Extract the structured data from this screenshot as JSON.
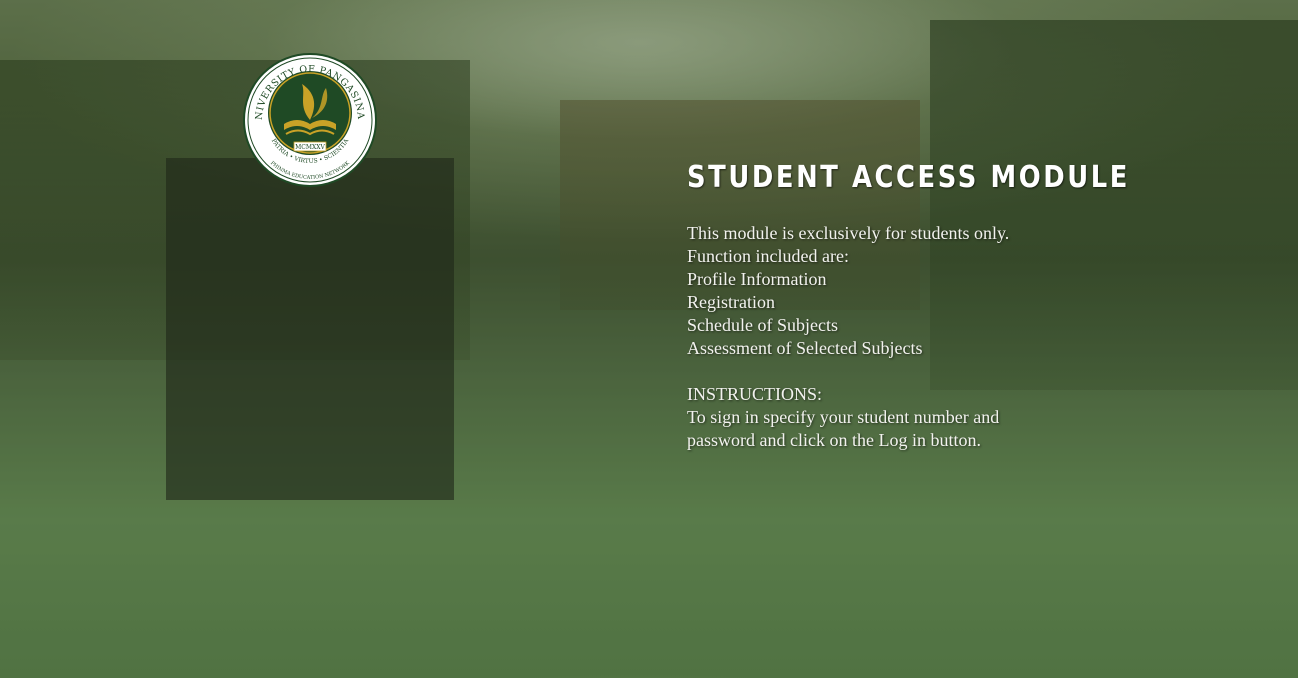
{
  "seal": {
    "top_text": "UNIVERSITY OF PANGASINAN",
    "motto": "PATRIA • VIRTUS • SCIENTIA",
    "year": "MCMXXV",
    "network": "PHINMA EDUCATION NETWORK",
    "colors": {
      "ring": "#ffffff",
      "inner": "#1f4a25",
      "gold": "#c9a227"
    }
  },
  "info": {
    "title": "STUDENT ACCESS MODULE",
    "intro": "This module is exclusively for students only.",
    "functions_heading": "Function included are:",
    "functions": [
      "Profile Information",
      "Registration",
      "Schedule of Subjects",
      "Assessment of Selected Subjects"
    ],
    "instructions_heading": "INSTRUCTIONS:",
    "instructions_line1": "To sign in specify your student number and",
    "instructions_line2": "password and click on the Log in button."
  },
  "theme": {
    "panel": "#1e2619",
    "overlay_green": "#3c5a2a",
    "text": "#f2f2ee"
  }
}
